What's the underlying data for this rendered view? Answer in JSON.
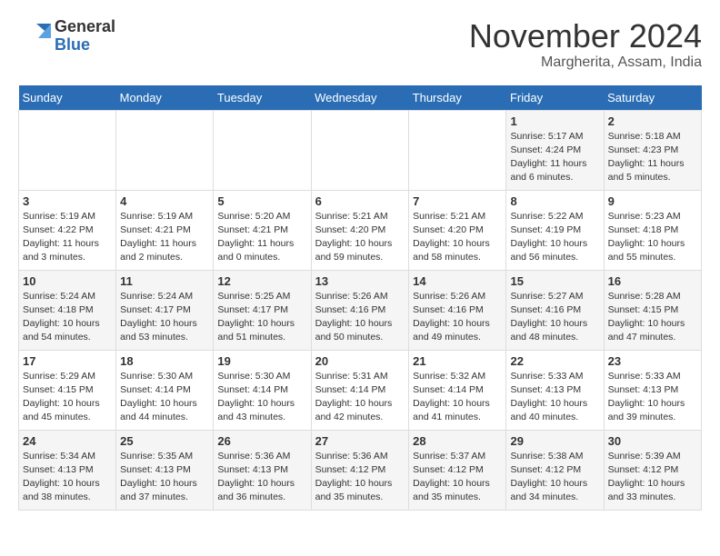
{
  "header": {
    "logo_line1": "General",
    "logo_line2": "Blue",
    "month": "November 2024",
    "location": "Margherita, Assam, India"
  },
  "weekdays": [
    "Sunday",
    "Monday",
    "Tuesday",
    "Wednesday",
    "Thursday",
    "Friday",
    "Saturday"
  ],
  "weeks": [
    [
      {
        "day": "",
        "info": ""
      },
      {
        "day": "",
        "info": ""
      },
      {
        "day": "",
        "info": ""
      },
      {
        "day": "",
        "info": ""
      },
      {
        "day": "",
        "info": ""
      },
      {
        "day": "1",
        "info": "Sunrise: 5:17 AM\nSunset: 4:24 PM\nDaylight: 11 hours\nand 6 minutes."
      },
      {
        "day": "2",
        "info": "Sunrise: 5:18 AM\nSunset: 4:23 PM\nDaylight: 11 hours\nand 5 minutes."
      }
    ],
    [
      {
        "day": "3",
        "info": "Sunrise: 5:19 AM\nSunset: 4:22 PM\nDaylight: 11 hours\nand 3 minutes."
      },
      {
        "day": "4",
        "info": "Sunrise: 5:19 AM\nSunset: 4:21 PM\nDaylight: 11 hours\nand 2 minutes."
      },
      {
        "day": "5",
        "info": "Sunrise: 5:20 AM\nSunset: 4:21 PM\nDaylight: 11 hours\nand 0 minutes."
      },
      {
        "day": "6",
        "info": "Sunrise: 5:21 AM\nSunset: 4:20 PM\nDaylight: 10 hours\nand 59 minutes."
      },
      {
        "day": "7",
        "info": "Sunrise: 5:21 AM\nSunset: 4:20 PM\nDaylight: 10 hours\nand 58 minutes."
      },
      {
        "day": "8",
        "info": "Sunrise: 5:22 AM\nSunset: 4:19 PM\nDaylight: 10 hours\nand 56 minutes."
      },
      {
        "day": "9",
        "info": "Sunrise: 5:23 AM\nSunset: 4:18 PM\nDaylight: 10 hours\nand 55 minutes."
      }
    ],
    [
      {
        "day": "10",
        "info": "Sunrise: 5:24 AM\nSunset: 4:18 PM\nDaylight: 10 hours\nand 54 minutes."
      },
      {
        "day": "11",
        "info": "Sunrise: 5:24 AM\nSunset: 4:17 PM\nDaylight: 10 hours\nand 53 minutes."
      },
      {
        "day": "12",
        "info": "Sunrise: 5:25 AM\nSunset: 4:17 PM\nDaylight: 10 hours\nand 51 minutes."
      },
      {
        "day": "13",
        "info": "Sunrise: 5:26 AM\nSunset: 4:16 PM\nDaylight: 10 hours\nand 50 minutes."
      },
      {
        "day": "14",
        "info": "Sunrise: 5:26 AM\nSunset: 4:16 PM\nDaylight: 10 hours\nand 49 minutes."
      },
      {
        "day": "15",
        "info": "Sunrise: 5:27 AM\nSunset: 4:16 PM\nDaylight: 10 hours\nand 48 minutes."
      },
      {
        "day": "16",
        "info": "Sunrise: 5:28 AM\nSunset: 4:15 PM\nDaylight: 10 hours\nand 47 minutes."
      }
    ],
    [
      {
        "day": "17",
        "info": "Sunrise: 5:29 AM\nSunset: 4:15 PM\nDaylight: 10 hours\nand 45 minutes."
      },
      {
        "day": "18",
        "info": "Sunrise: 5:30 AM\nSunset: 4:14 PM\nDaylight: 10 hours\nand 44 minutes."
      },
      {
        "day": "19",
        "info": "Sunrise: 5:30 AM\nSunset: 4:14 PM\nDaylight: 10 hours\nand 43 minutes."
      },
      {
        "day": "20",
        "info": "Sunrise: 5:31 AM\nSunset: 4:14 PM\nDaylight: 10 hours\nand 42 minutes."
      },
      {
        "day": "21",
        "info": "Sunrise: 5:32 AM\nSunset: 4:14 PM\nDaylight: 10 hours\nand 41 minutes."
      },
      {
        "day": "22",
        "info": "Sunrise: 5:33 AM\nSunset: 4:13 PM\nDaylight: 10 hours\nand 40 minutes."
      },
      {
        "day": "23",
        "info": "Sunrise: 5:33 AM\nSunset: 4:13 PM\nDaylight: 10 hours\nand 39 minutes."
      }
    ],
    [
      {
        "day": "24",
        "info": "Sunrise: 5:34 AM\nSunset: 4:13 PM\nDaylight: 10 hours\nand 38 minutes."
      },
      {
        "day": "25",
        "info": "Sunrise: 5:35 AM\nSunset: 4:13 PM\nDaylight: 10 hours\nand 37 minutes."
      },
      {
        "day": "26",
        "info": "Sunrise: 5:36 AM\nSunset: 4:13 PM\nDaylight: 10 hours\nand 36 minutes."
      },
      {
        "day": "27",
        "info": "Sunrise: 5:36 AM\nSunset: 4:12 PM\nDaylight: 10 hours\nand 35 minutes."
      },
      {
        "day": "28",
        "info": "Sunrise: 5:37 AM\nSunset: 4:12 PM\nDaylight: 10 hours\nand 35 minutes."
      },
      {
        "day": "29",
        "info": "Sunrise: 5:38 AM\nSunset: 4:12 PM\nDaylight: 10 hours\nand 34 minutes."
      },
      {
        "day": "30",
        "info": "Sunrise: 5:39 AM\nSunset: 4:12 PM\nDaylight: 10 hours\nand 33 minutes."
      }
    ]
  ]
}
